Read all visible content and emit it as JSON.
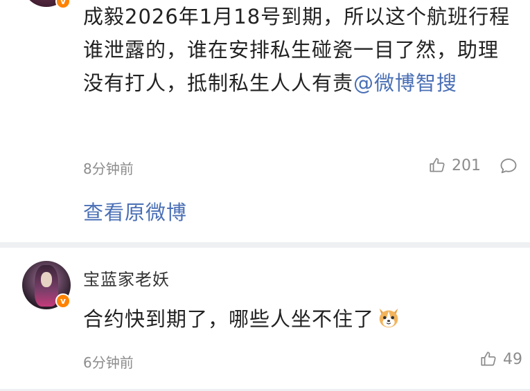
{
  "post": {
    "text": "成毅2026年1月18号到期，所以这个航班行程谁泄露的，谁在安排私生碰瓷一目了然，助理没有打人，抵制私生人人有责",
    "mention": "@微博智搜",
    "time": "8分钟前",
    "likes": "201",
    "view_original": "查看原微博",
    "verified_badge": "v"
  },
  "comment": {
    "username": "宝蓝家老妖",
    "text": "合约快到期了，哪些人坐不住了",
    "emoji": "dog-emoji",
    "time": "6分钟前",
    "likes": "49",
    "verified_badge": "v"
  },
  "colors": {
    "link": "#4a6fb5",
    "meta": "#8c8c8c",
    "badge": "#ff8200",
    "divider": "#eef0f2"
  }
}
